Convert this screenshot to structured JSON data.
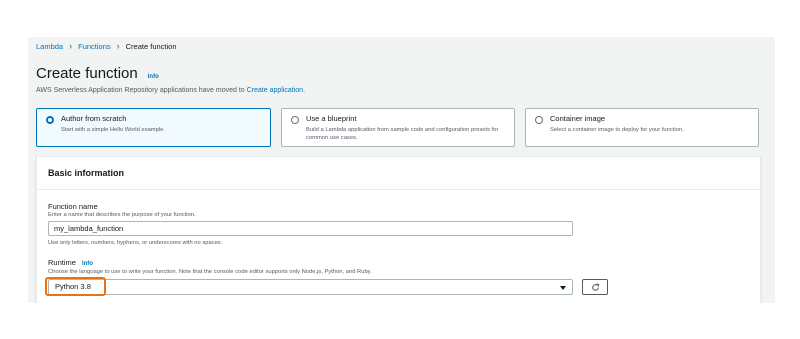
{
  "breadcrumb": {
    "items": [
      "Lambda",
      "Functions"
    ],
    "current": "Create function"
  },
  "header": {
    "title": "Create function",
    "info": "Info",
    "notice_prefix": "AWS Serverless Application Repository applications have moved to ",
    "notice_link": "Create application",
    "notice_suffix": "."
  },
  "options": [
    {
      "title": "Author from scratch",
      "description": "Start with a simple Hello World example.",
      "selected": true
    },
    {
      "title": "Use a blueprint",
      "description": "Build a Lambda application from sample code and configuration presets for common use cases.",
      "selected": false
    },
    {
      "title": "Container image",
      "description": "Select a container image to deploy for your function.",
      "selected": false
    }
  ],
  "basic_info": {
    "title": "Basic information",
    "function_name": {
      "label": "Function name",
      "description": "Enter a name that describes the purpose of your function.",
      "value": "my_lambda_function",
      "constraint": "Use only letters, numbers, hyphens, or underscores with no spaces."
    },
    "runtime": {
      "label": "Runtime",
      "info": "Info",
      "description": "Choose the language to use to write your function. Note that the console code editor supports only Node.js, Python, and Ruby.",
      "value": "Python 3.8"
    }
  },
  "colors": {
    "link": "#0073bb",
    "highlight": "#ec7211",
    "selected_card_bg": "#f1faff"
  }
}
